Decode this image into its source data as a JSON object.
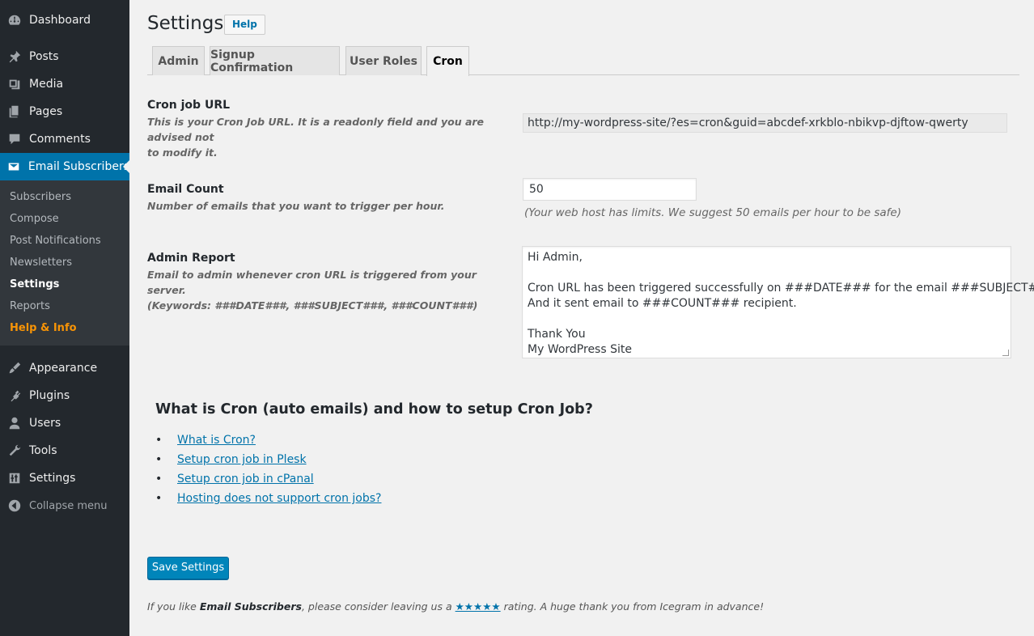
{
  "sidebar": {
    "menu": [
      {
        "label": "Dashboard",
        "icon": "dashboard-icon"
      },
      {
        "label": "Posts",
        "icon": "pin-icon"
      },
      {
        "label": "Media",
        "icon": "media-icon"
      },
      {
        "label": "Pages",
        "icon": "pages-icon"
      },
      {
        "label": "Comments",
        "icon": "comment-icon"
      },
      {
        "label": "Email Subscribers",
        "icon": "envelope-icon"
      }
    ],
    "submenu": [
      "Subscribers",
      "Compose",
      "Post Notifications",
      "Newsletters",
      "Settings",
      "Reports",
      "Help & Info"
    ],
    "menu_bottom": [
      {
        "label": "Appearance",
        "icon": "brush-icon"
      },
      {
        "label": "Plugins",
        "icon": "plug-icon"
      },
      {
        "label": "Users",
        "icon": "user-icon"
      },
      {
        "label": "Tools",
        "icon": "wrench-icon"
      },
      {
        "label": "Settings",
        "icon": "sliders-icon"
      },
      {
        "label": "Collapse menu",
        "icon": "collapse-icon"
      }
    ]
  },
  "header": {
    "title": "Settings",
    "help_label": "Help"
  },
  "tabs": [
    "Admin",
    "Signup Confirmation",
    "User Roles",
    "Cron"
  ],
  "fields": {
    "cron_url": {
      "label": "Cron job URL",
      "desc_1": "This is your Cron Job URL. It is a readonly field and you are advised not",
      "desc_2": "to modify it.",
      "value": "http://my-wordpress-site/?es=cron&guid=abcdef-xrkblo-nbikvp-djftow-qwerty"
    },
    "email_count": {
      "label": "Email Count",
      "desc": "Number of emails that you want to trigger per hour.",
      "value": "50",
      "hint": "(Your web host has limits. We suggest 50 emails per hour to be safe)"
    },
    "admin_report": {
      "label": "Admin Report",
      "desc_1": "Email to admin whenever cron URL is triggered from your server.",
      "desc_2": "(Keywords: ###DATE###, ###SUBJECT###, ###COUNT###)",
      "lines": [
        "Hi Admin,",
        "",
        "Cron URL has been triggered successfully on ###DATE### for the email ###SUBJECT###.",
        "And it sent email to ###COUNT### recipient.",
        "",
        "Thank You",
        "My WordPress Site"
      ]
    }
  },
  "cron_help": {
    "heading": "What is Cron (auto emails) and how to setup Cron Job?",
    "links": [
      "What is Cron?",
      "Setup cron job in Plesk",
      "Setup cron job in cPanal",
      "Hosting does not support cron jobs?"
    ]
  },
  "save_label": "Save Settings",
  "footer": {
    "part1": "If you like ",
    "brand": "Email Subscribers",
    "part2": ", please consider leaving us a ",
    "stars": "★★★★★",
    "part3": " rating. A huge thank you from Icegram in advance!"
  },
  "colors": {
    "accent": "#0073aa",
    "sidebar": "#23282d",
    "submenu": "#32373c",
    "highlight": "#f89406"
  }
}
